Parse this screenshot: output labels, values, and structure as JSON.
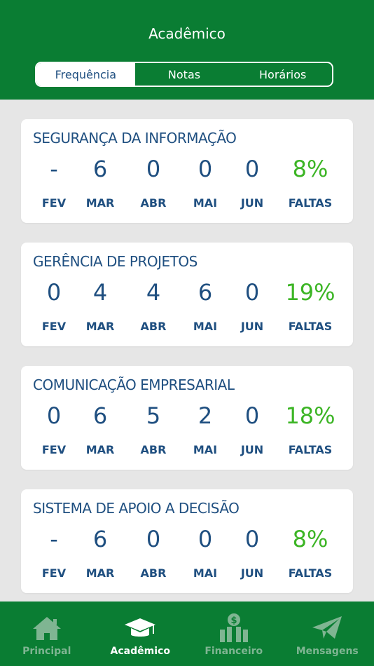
{
  "header": {
    "title": "Acadêmico"
  },
  "tabs": [
    {
      "label": "Frequência"
    },
    {
      "label": "Notas"
    },
    {
      "label": "Horários"
    }
  ],
  "months": [
    "FEV",
    "MAR",
    "ABR",
    "MAI",
    "JUN"
  ],
  "faltas_label": "FALTAS",
  "courses": [
    {
      "name": "SEGURANÇA DA INFORMAÇÃO",
      "values": [
        "-",
        "6",
        "0",
        "0",
        "0"
      ],
      "faltas": "8%"
    },
    {
      "name": "GERÊNCIA DE PROJETOS",
      "values": [
        "0",
        "4",
        "4",
        "6",
        "0"
      ],
      "faltas": "19%"
    },
    {
      "name": "COMUNICAÇÃO EMPRESARIAL",
      "values": [
        "0",
        "6",
        "5",
        "2",
        "0"
      ],
      "faltas": "18%"
    },
    {
      "name": "SISTEMA DE APOIO A DECISÃO",
      "values": [
        "-",
        "6",
        "0",
        "0",
        "0"
      ],
      "faltas": "8%"
    }
  ],
  "nav": [
    {
      "label": "Principal",
      "icon": "home-icon"
    },
    {
      "label": "Acadêmico",
      "icon": "graduation-cap-icon"
    },
    {
      "label": "Financeiro",
      "icon": "money-chart-icon"
    },
    {
      "label": "Mensagens",
      "icon": "paper-plane-icon"
    }
  ],
  "colors": {
    "brand_green": "#0a7d33",
    "text_blue": "#1f4f80",
    "faltas_green": "#3cb525",
    "background": "#e6e6e6"
  }
}
